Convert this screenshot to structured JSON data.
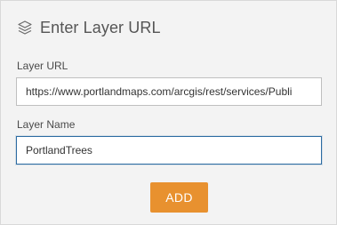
{
  "dialog": {
    "title": "Enter Layer URL",
    "icon": "layers-icon"
  },
  "layer_url": {
    "label": "Layer URL",
    "value": "https://www.portlandmaps.com/arcgis/rest/services/Publi",
    "placeholder": ""
  },
  "layer_name": {
    "label": "Layer Name",
    "value": "PortlandTrees",
    "placeholder": ""
  },
  "actions": {
    "add_label": "ADD"
  },
  "colors": {
    "accent": "#e8912f",
    "focus_border": "#2d6ca2",
    "panel_background": "#f3f3f3"
  }
}
